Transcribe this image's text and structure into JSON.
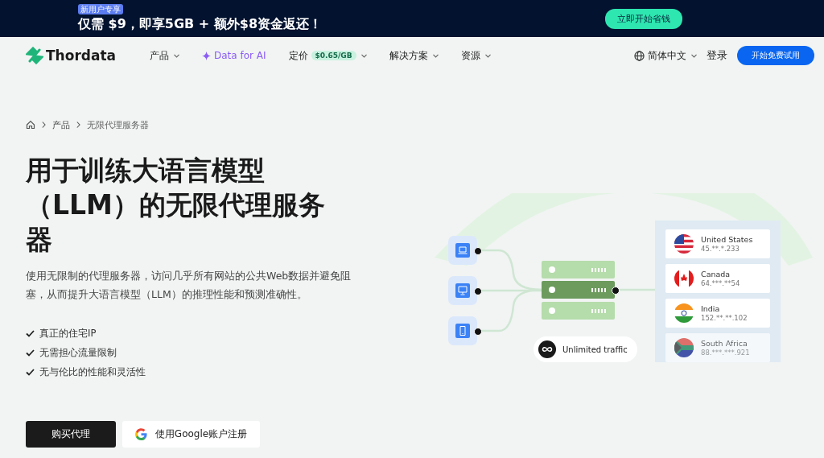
{
  "promo_banner": {
    "badge": "新用户专享",
    "headline": "仅需 $9，即享5GB + 额外$8资金返还！",
    "button": "立即开始省钱"
  },
  "nav": {
    "logo": "Thordata",
    "items": [
      {
        "kind": "dropdown",
        "label": "产品"
      },
      {
        "kind": "ai",
        "label": "Data for AI"
      },
      {
        "kind": "price",
        "label": "定价",
        "badge": "$0.65/GB"
      },
      {
        "kind": "dropdown",
        "label": "解决方案"
      },
      {
        "kind": "dropdown",
        "label": "资源"
      }
    ],
    "language": "简体中文",
    "login": "登录",
    "trial_button": "开始免费试用"
  },
  "breadcrumb": [
    "产品",
    "无限代理服务器"
  ],
  "hero": {
    "title": "用于训练大语言模型（LLM）的无限代理服务器",
    "description": "使用无限制的代理服务器，访问几乎所有网站的公共Web数据并避免阻塞，从而提升大语言模型（LLM）的推理性能和预测准确性。",
    "features": [
      "真正的住宅IP",
      "无需担心流量限制",
      "无与伦比的性能和灵活性"
    ],
    "buy_button": "购买代理",
    "google_button": "使用Google账户注册"
  },
  "diagram": {
    "devices": [
      {
        "kind": "laptop"
      },
      {
        "kind": "monitor"
      },
      {
        "kind": "tablet"
      }
    ],
    "servers": [
      {
        "selected": false
      },
      {
        "selected": true
      },
      {
        "selected": false
      }
    ],
    "traffic_label": "Unlimited traffic",
    "locations": [
      {
        "kind": "us",
        "country": "United States",
        "ip": "45.**.*.233",
        "faded": false
      },
      {
        "kind": "ca",
        "country": "Canada",
        "ip": "64.***.**54",
        "faded": false
      },
      {
        "kind": "in",
        "country": "India",
        "ip": "152.**.**.102",
        "faded": false
      },
      {
        "kind": "za",
        "country": "South Africa",
        "ip": "88.***.***.921",
        "faded": true
      }
    ]
  }
}
